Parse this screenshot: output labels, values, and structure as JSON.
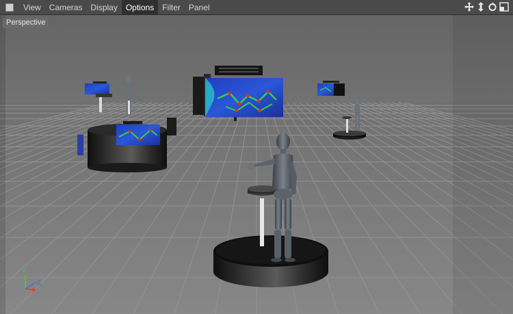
{
  "menu": {
    "items": [
      {
        "label": "View",
        "active": false
      },
      {
        "label": "Cameras",
        "active": false
      },
      {
        "label": "Display",
        "active": false
      },
      {
        "label": "Options",
        "active": true
      },
      {
        "label": "Filter",
        "active": false
      },
      {
        "label": "Panel",
        "active": false
      }
    ]
  },
  "nav_icons": [
    "move-view-icon",
    "dolly-view-icon",
    "rotate-view-icon",
    "toggle-layout-icon"
  ],
  "viewport": {
    "label": "Perspective",
    "axes": {
      "y": "Y",
      "x": "X",
      "z": "Z"
    }
  },
  "colors": {
    "menubar": "#4a4a4a",
    "viewport_sky": "#6b6b6b",
    "floor": "#7a7a7a",
    "axis_y": "#3fcf3f",
    "axis_x": "#e03a2a",
    "axis_z": "#3a6fe0"
  }
}
